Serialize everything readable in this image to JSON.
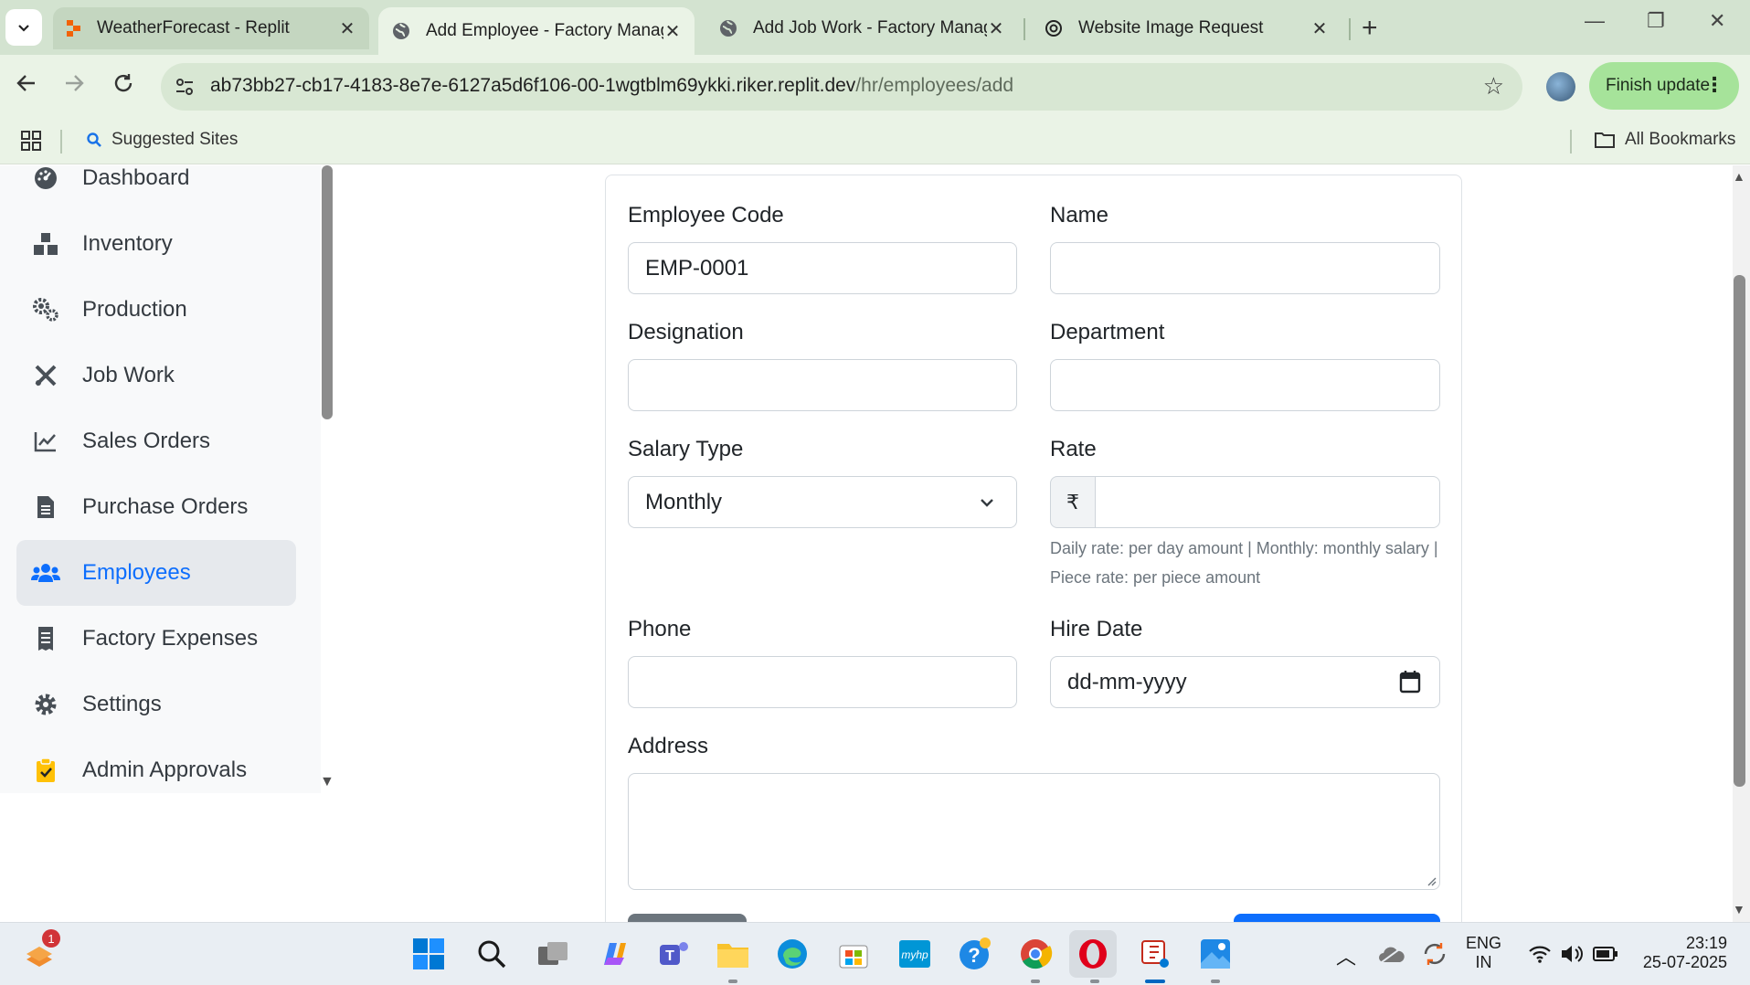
{
  "browser": {
    "tabs": [
      {
        "title": "WeatherForecast - Replit",
        "icon": "replit-icon",
        "active": false
      },
      {
        "title": "Add Employee - Factory Manag",
        "icon": "globe-icon",
        "active": true
      },
      {
        "title": "Add Job Work - Factory Manage",
        "icon": "globe-icon",
        "active": false
      },
      {
        "title": "Website Image Request",
        "icon": "openai-icon",
        "active": false
      }
    ],
    "url_host": "ab73bb27-cb17-4183-8e7e-6127a5d6f106-00-1wgtblm69ykki.riker.replit.dev",
    "url_path": "/hr/employees/add",
    "finish_update": "Finish update",
    "bookmarks": {
      "suggested": "Suggested Sites",
      "all": "All Bookmarks"
    }
  },
  "sidebar": {
    "items": [
      {
        "label": "Dashboard",
        "icon": "gauge-icon",
        "active": false
      },
      {
        "label": "Inventory",
        "icon": "boxes-icon",
        "active": false
      },
      {
        "label": "Production",
        "icon": "cogs-icon",
        "active": false
      },
      {
        "label": "Job Work",
        "icon": "tools-icon",
        "active": false
      },
      {
        "label": "Sales Orders",
        "icon": "chart-line-icon",
        "active": false
      },
      {
        "label": "Purchase Orders",
        "icon": "file-invoice-icon",
        "active": false
      },
      {
        "label": "Employees",
        "icon": "users-icon",
        "active": true
      },
      {
        "label": "Factory Expenses",
        "icon": "receipt-icon",
        "active": false
      },
      {
        "label": "Settings",
        "icon": "gear-icon",
        "active": false
      },
      {
        "label": "Admin Approvals",
        "icon": "clipboard-check-icon",
        "active": false
      }
    ]
  },
  "form": {
    "employee_code": {
      "label": "Employee Code",
      "value": "EMP-0001"
    },
    "name": {
      "label": "Name",
      "value": ""
    },
    "designation": {
      "label": "Designation",
      "value": ""
    },
    "department": {
      "label": "Department",
      "value": ""
    },
    "salary_type": {
      "label": "Salary Type",
      "value": "Monthly"
    },
    "rate": {
      "label": "Rate",
      "currency": "₹",
      "value": "",
      "help": "Daily rate: per day amount | Monthly: monthly salary | Piece rate: per piece amount"
    },
    "phone": {
      "label": "Phone",
      "value": ""
    },
    "hire_date": {
      "label": "Hire Date",
      "placeholder": "dd-mm-yyyy"
    },
    "address": {
      "label": "Address",
      "value": ""
    }
  },
  "taskbar": {
    "lang_line1": "ENG",
    "lang_line2": "IN",
    "time": "23:19",
    "date": "25-07-2025",
    "badge": "1"
  },
  "colors": {
    "primary": "#0d6efd",
    "chrome_green": "#d3e3d0",
    "finish_btn": "#a6e39a"
  }
}
